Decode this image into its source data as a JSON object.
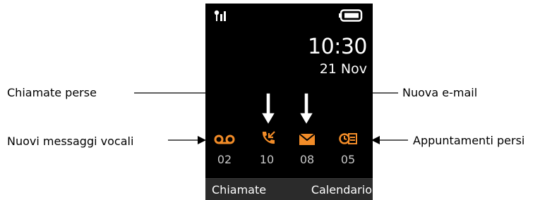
{
  "screen": {
    "time": "10:30",
    "date": "21 Nov",
    "icons": {
      "signal": "signal-strength-icon",
      "battery": "battery-icon",
      "voicemail": "voicemail-icon",
      "missed_calls": "missed-call-icon",
      "email": "envelope-icon",
      "appointments": "missed-appointment-icon"
    },
    "counts": {
      "voicemail": "02",
      "missed_calls": "10",
      "email": "08",
      "appointments": "05"
    },
    "softkeys": {
      "left": "Chiamate",
      "right": "Calendario"
    }
  },
  "callouts": {
    "missed_calls": "Chiamate perse",
    "voicemail": "Nuovi messaggi vocali",
    "email": "Nuova e-mail",
    "appointments": "Appuntamenti persi"
  },
  "colors": {
    "screen_bg": "#000000",
    "accent": "#f28c28",
    "count_text": "#c8c8c8",
    "softbar_bg": "#2b2b2b"
  }
}
